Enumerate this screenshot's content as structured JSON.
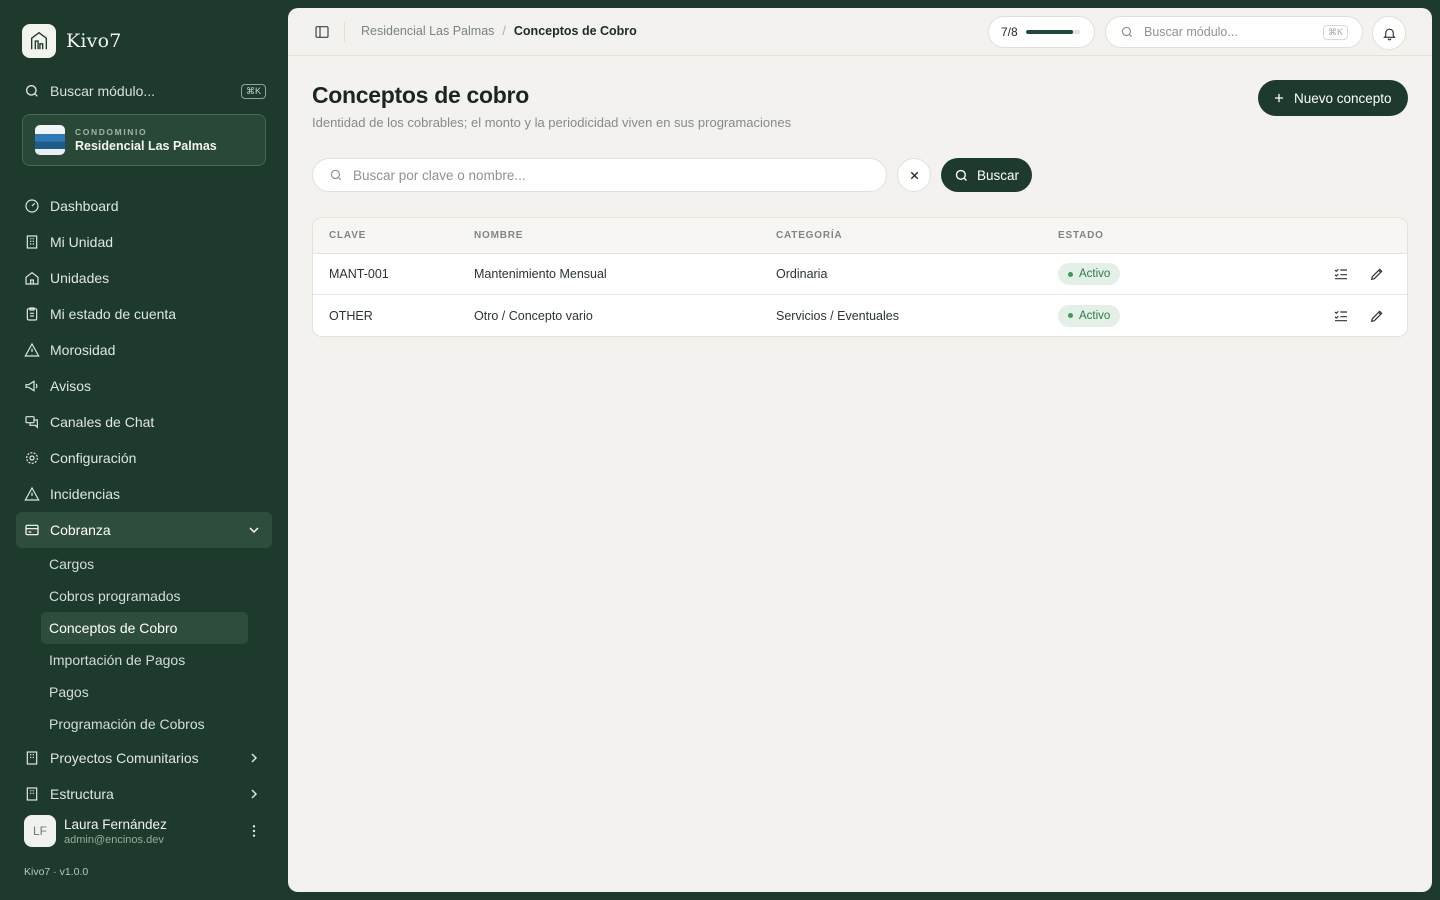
{
  "app": {
    "name": "Kivo7",
    "version": "Kivo7 · v1.0.0"
  },
  "sidebar": {
    "search": {
      "placeholder": "Buscar módulo...",
      "shortcut": "⌘K"
    },
    "condo": {
      "kicker": "CONDOMINIO",
      "name": "Residencial Las Palmas"
    },
    "items": [
      {
        "label": "Dashboard",
        "icon": "gauge-icon"
      },
      {
        "label": "Mi Unidad",
        "icon": "building-icon"
      },
      {
        "label": "Unidades",
        "icon": "home-icon"
      },
      {
        "label": "Mi estado de cuenta",
        "icon": "clipboard-icon"
      },
      {
        "label": "Morosidad",
        "icon": "alert-triangle-icon"
      },
      {
        "label": "Avisos",
        "icon": "megaphone-icon"
      },
      {
        "label": "Canales de Chat",
        "icon": "chat-icon"
      },
      {
        "label": "Configuración",
        "icon": "gear-icon"
      },
      {
        "label": "Incidencias",
        "icon": "alert-triangle-icon"
      },
      {
        "label": "Cobranza",
        "icon": "credit-card-icon",
        "expanded": true
      }
    ],
    "subitems": [
      {
        "label": "Cargos"
      },
      {
        "label": "Cobros programados"
      },
      {
        "label": "Conceptos de Cobro",
        "active": true
      },
      {
        "label": "Importación de Pagos"
      },
      {
        "label": "Pagos"
      },
      {
        "label": "Programación de Cobros"
      }
    ],
    "bottom_items": [
      {
        "label": "Proyectos Comunitarios",
        "icon": "building-icon"
      },
      {
        "label": "Estructura",
        "icon": "building-icon"
      }
    ],
    "user": {
      "initials": "LF",
      "name": "Laura Fernández",
      "email": "admin@encinos.dev"
    }
  },
  "topbar": {
    "breadcrumb": {
      "parent": "Residencial Las Palmas",
      "separator": "/",
      "current": "Conceptos de Cobro"
    },
    "progress": {
      "label": "7/8",
      "fraction": 0.875
    },
    "search": {
      "placeholder": "Buscar módulo...",
      "shortcut": "⌘K"
    }
  },
  "page": {
    "title": "Conceptos de cobro",
    "subtitle": "Identidad de los cobrables; el monto y la periodicidad viven en sus programaciones",
    "new_button": "Nuevo concepto",
    "search_placeholder": "Buscar por clave o nombre...",
    "search_button": "Buscar"
  },
  "table": {
    "columns": [
      "CLAVE",
      "NOMBRE",
      "CATEGORÍA",
      "ESTADO"
    ],
    "rows": [
      {
        "clave": "MANT-001",
        "nombre": "Mantenimiento Mensual",
        "categoria": "Ordinaria",
        "estado": "Activo"
      },
      {
        "clave": "OTHER",
        "nombre": "Otro / Concepto vario",
        "categoria": "Servicios / Eventuales",
        "estado": "Activo"
      }
    ]
  },
  "colors": {
    "sidebar_bg": "#1e3a2c",
    "accent": "#1e3a2c",
    "status_active": "#2f7a47",
    "panel_bg": "#f3f2ee"
  }
}
